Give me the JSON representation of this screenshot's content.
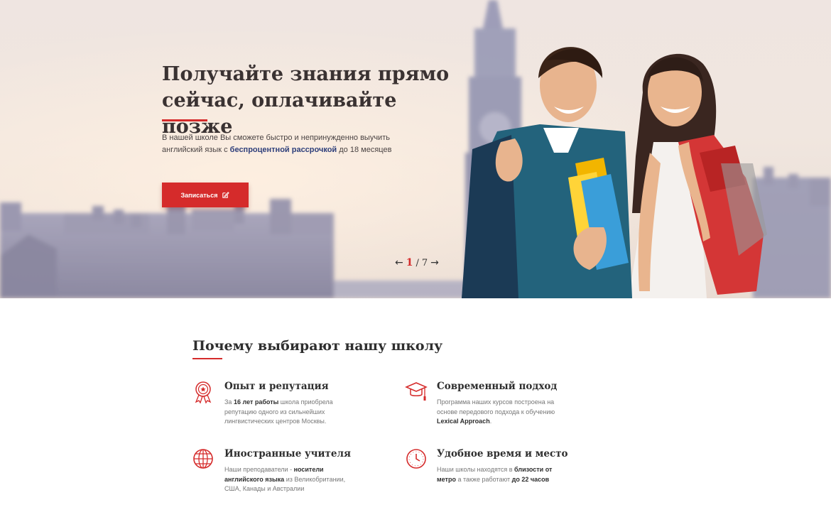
{
  "hero": {
    "title": "Получайте знания прямо сейчас, оплачивайте позже",
    "text_before": "В нашей школе Вы сможете быстро и непринужденно выучить английский язык с ",
    "text_bold": "беспроцентной рассрочкой",
    "text_after": " до 18 месяцев",
    "cta_label": "Записаться",
    "cta_icon": "edit-icon",
    "pager": {
      "prev": "←",
      "current": "1",
      "separator": "/",
      "total": "7",
      "next": "→"
    }
  },
  "why": {
    "title": "Почему выбирают нашу школу",
    "features": [
      {
        "title": "Опыт и репутация",
        "icon": "award-ribbon-icon",
        "parts": [
          {
            "t": "За ",
            "b": false
          },
          {
            "t": "16 лет работы",
            "b": true
          },
          {
            "t": " школа приобрела репутацию одного из сильнейших лингвистических центров Москвы.",
            "b": false
          }
        ]
      },
      {
        "title": "Современный подход",
        "icon": "graduation-cap-icon",
        "parts": [
          {
            "t": "Программа наших курсов построена на основе передового подхода к обучению ",
            "b": false
          },
          {
            "t": "Lexical Approach",
            "b": true
          },
          {
            "t": ".",
            "b": false
          }
        ]
      },
      {
        "title": "Иностранные учителя",
        "icon": "globe-icon",
        "parts": [
          {
            "t": "Наши преподаватели - ",
            "b": false
          },
          {
            "t": "носители английского языка",
            "b": true
          },
          {
            "t": " из Великобритании, США, Канады и Австралии",
            "b": false
          }
        ]
      },
      {
        "title": "Удобное время и место",
        "icon": "clock-icon",
        "parts": [
          {
            "t": "Наши школы находятся в ",
            "b": false
          },
          {
            "t": "близости от метро",
            "b": true
          },
          {
            "t": " а также работают ",
            "b": false
          },
          {
            "t": "до 22 часов",
            "b": true
          }
        ]
      }
    ]
  },
  "colors": {
    "accent": "#d52b2b",
    "link": "#2d3e7a",
    "heading": "#2e2e2e"
  }
}
